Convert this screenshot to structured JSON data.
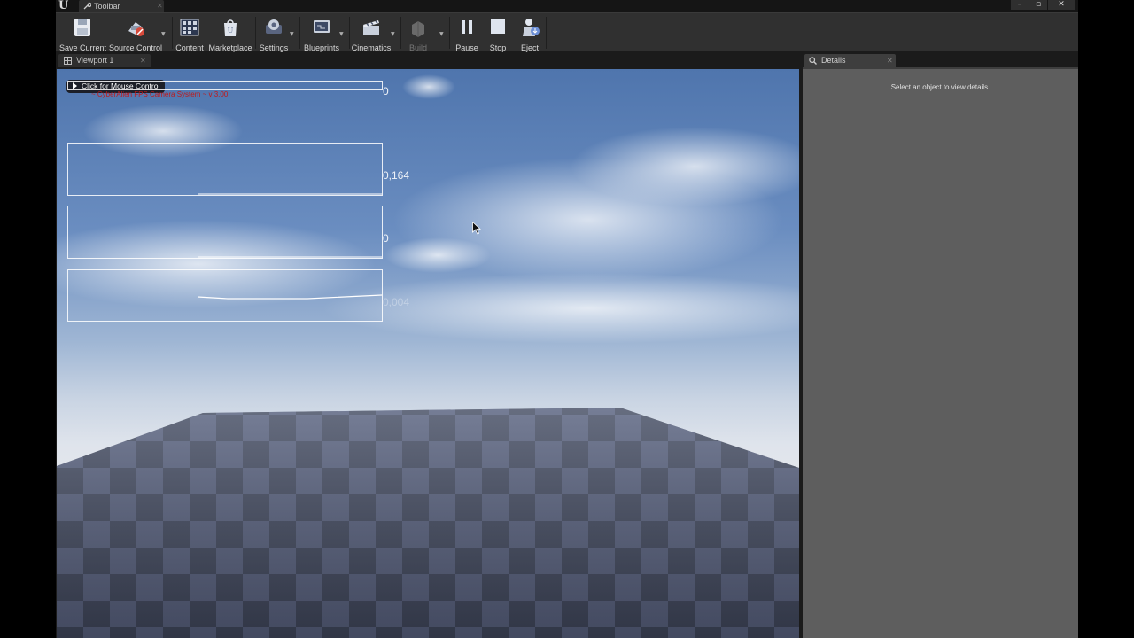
{
  "window": {
    "tab_title": "Toolbar",
    "tab_icon": "wrench-icon",
    "controls": {
      "minimize": "–",
      "maximize": "▫",
      "close": "✕"
    }
  },
  "toolbar": {
    "save_current": "Save Current",
    "source_control": "Source Control",
    "content": "Content",
    "marketplace": "Marketplace",
    "settings": "Settings",
    "blueprints": "Blueprints",
    "cinematics": "Cinematics",
    "build": "Build",
    "pause": "Pause",
    "stop": "Stop",
    "eject": "Eject"
  },
  "viewport_tab": {
    "label": "Viewport 1",
    "icon": "viewport-icon"
  },
  "details_tab": {
    "label": "Details",
    "icon": "search-icon",
    "empty_message": "Select an object to view details."
  },
  "viewport": {
    "mouse_control_label": "Click for Mouse Control",
    "system_text": "~ CyberAlien FPS Camera System ~ v 3.00",
    "graph_values": [
      "0",
      "0,164",
      "0",
      "0,004"
    ]
  },
  "colors": {
    "editor_bg": "#1b1b1b",
    "toolbar_bg": "#303030",
    "details_bg": "#5e5e5e",
    "sky_top": "#4f75ad",
    "floor_dark": "#3c4252",
    "floor_light": "#58607a",
    "debug_text": "#c21818"
  }
}
